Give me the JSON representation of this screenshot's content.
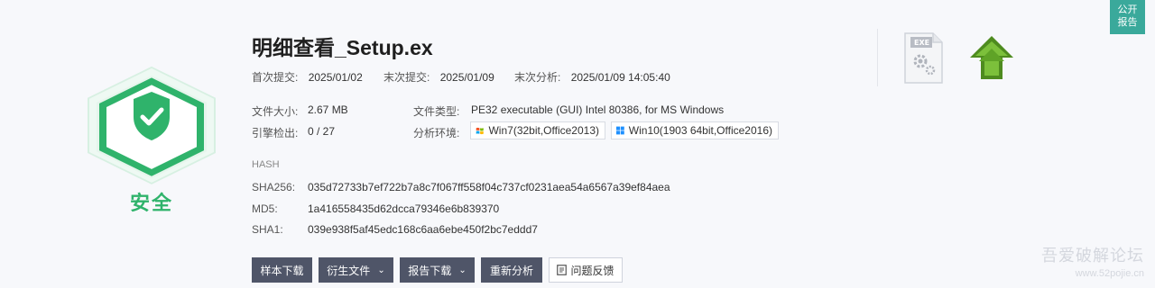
{
  "verdict": {
    "label": "安全",
    "color": "#2fb36b"
  },
  "file": {
    "name": "明细查看_Setup.ex"
  },
  "dates": {
    "first_submit_label": "首次提交:",
    "first_submit": "2025/01/02",
    "last_submit_label": "末次提交:",
    "last_submit": "2025/01/09",
    "last_analysis_label": "末次分析:",
    "last_analysis": "2025/01/09 14:05:40"
  },
  "details": {
    "size_label": "文件大小:",
    "size": "2.67 MB",
    "type_label": "文件类型:",
    "type": "PE32 executable (GUI) Intel 80386, for MS Windows",
    "engine_label": "引擎检出:",
    "engine": "0 / 27",
    "env_label": "分析环境:",
    "envs": [
      {
        "icon": "windows-7-flag-icon",
        "label": "Win7(32bit,Office2013)"
      },
      {
        "icon": "windows-10-logo-icon",
        "label": "Win10(1903 64bit,Office2016)"
      }
    ]
  },
  "hash": {
    "heading": "HASH",
    "sha256_label": "SHA256:",
    "sha256": "035d72733b7ef722b7a8c7f067ff558f04c737cf0231aea54a6567a39ef84aea",
    "md5_label": "MD5:",
    "md5": "1a416558435d62dcca79346e6b839370",
    "sha1_label": "SHA1:",
    "sha1": "039e938f5af45edc168c6aa6ebe450f2bc7eddd7"
  },
  "icons": {
    "file_type": "exe-file-icon",
    "upload": "green-up-arrow-icon",
    "exe_tag": "EXE"
  },
  "actions": {
    "sample_download": "样本下载",
    "derived_files": "衍生文件",
    "report_download": "报告下载",
    "reanalyze": "重新分析",
    "feedback": "问题反馈"
  },
  "public_report": {
    "line1": "公开",
    "line2": "报告"
  },
  "watermark": {
    "line1": "吾爱破解论坛",
    "line2": "www.52pojie.cn"
  }
}
